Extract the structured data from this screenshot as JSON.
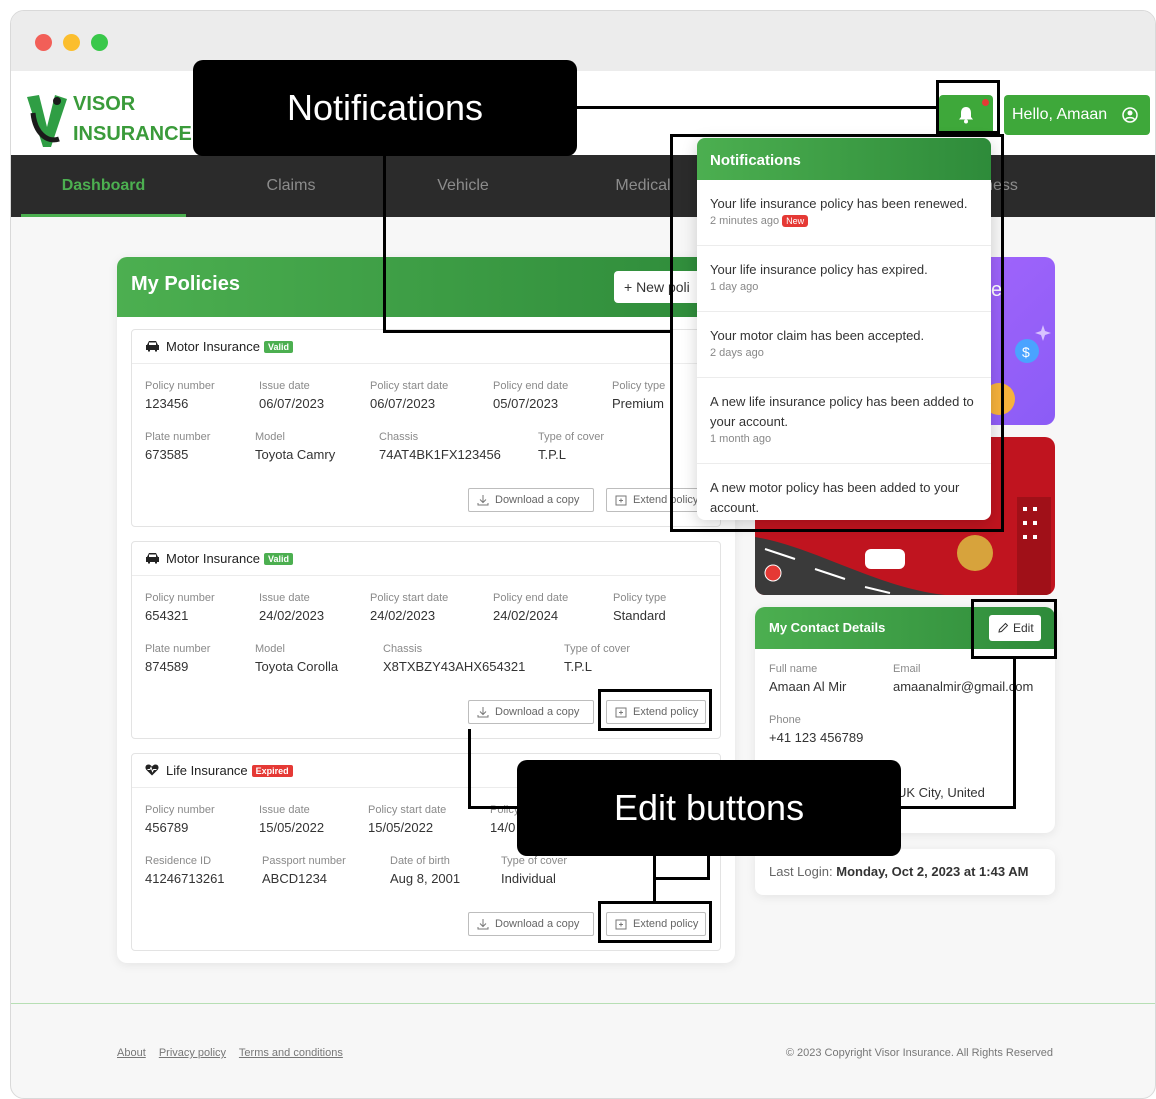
{
  "brand": {
    "line1": "VISOR",
    "line2": "INSURANCE"
  },
  "header": {
    "greeting": "Hello, Amaan"
  },
  "nav": [
    "Dashboard",
    "Claims",
    "Vehicle",
    "Medical",
    "ness"
  ],
  "policies": {
    "title": "My Policies",
    "new_label": "+ New poli",
    "download_label": "Download a copy",
    "extend_label": "Extend policy",
    "extend_label_clipped": "Extend policy",
    "cards": [
      {
        "title": "Motor Insurance",
        "badge": "Valid",
        "row1": [
          {
            "label": "Policy number",
            "value": "123456"
          },
          {
            "label": "Issue date",
            "value": "06/07/2023"
          },
          {
            "label": "Policy start date",
            "value": "06/07/2023"
          },
          {
            "label": "Policy end date",
            "value": "05/07/2023"
          },
          {
            "label": "Policy type",
            "value": "Premium"
          }
        ],
        "row2": [
          {
            "label": "Plate number",
            "value": "673585"
          },
          {
            "label": "Model",
            "value": "Toyota Camry"
          },
          {
            "label": "Chassis",
            "value": "74AT4BK1FX123456"
          },
          {
            "label": "Type of cover",
            "value": "T.P.L"
          }
        ]
      },
      {
        "title": "Motor Insurance",
        "badge": "Valid",
        "row1": [
          {
            "label": "Policy number",
            "value": "654321"
          },
          {
            "label": "Issue date",
            "value": "24/02/2023"
          },
          {
            "label": "Policy start date",
            "value": "24/02/2023"
          },
          {
            "label": "Policy end date",
            "value": "24/02/2024"
          },
          {
            "label": "Policy type",
            "value": "Standard"
          }
        ],
        "row2": [
          {
            "label": "Plate number",
            "value": "874589"
          },
          {
            "label": "Model",
            "value": "Toyota Corolla"
          },
          {
            "label": "Chassis",
            "value": "X8TXBZY43AHX654321"
          },
          {
            "label": "Type of cover",
            "value": "T.P.L"
          }
        ]
      },
      {
        "title": "Life Insurance",
        "badge": "Expired",
        "row1": [
          {
            "label": "Policy number",
            "value": "456789"
          },
          {
            "label": "Issue date",
            "value": "15/05/2022"
          },
          {
            "label": "Policy start date",
            "value": "15/05/2022"
          },
          {
            "label": "Policy",
            "value": "14/0"
          }
        ],
        "row2": [
          {
            "label": "Residence ID",
            "value": "41246713261"
          },
          {
            "label": "Passport number",
            "value": "ABCD1234"
          },
          {
            "label": "Date of birth",
            "value": "Aug 8, 2001"
          },
          {
            "label": "Type of cover",
            "value": "Individual"
          }
        ]
      }
    ]
  },
  "contact": {
    "title": "My Contact Details",
    "edit_label": "Edit",
    "fullname_label": "Full name",
    "fullname": "Amaan Al Mir",
    "email_label": "Email",
    "email": "amaanalmir@gmail.com",
    "phone_label": "Phone",
    "phone": "+41 123 456789",
    "address_partial": "UK City, United"
  },
  "last_login": {
    "label": "Last Login:",
    "value": "Monday, Oct 2, 2023 at 1:43 AM"
  },
  "promo1_partial": "e",
  "notifications": {
    "title": "Notifications",
    "new_badge": "New",
    "items": [
      {
        "text": "Your life insurance policy has been renewed.",
        "time": "2 minutes ago"
      },
      {
        "text": "Your life insurance policy has expired.",
        "time": "1 day ago"
      },
      {
        "text": "Your motor claim has been accepted.",
        "time": "2 days ago"
      },
      {
        "text": "A new life insurance policy has been added to your account.",
        "time": "1 month ago"
      },
      {
        "text": "A new motor policy has been added to your account.",
        "time": ""
      }
    ]
  },
  "footer": {
    "links": [
      "About",
      "Privacy policy",
      "Terms and conditions"
    ],
    "copyright": "© 2023 Copyright Visor Insurance. All Rights Reserved"
  },
  "callouts": {
    "notifications": "Notifications",
    "edit": "Edit buttons"
  },
  "colors": {
    "brand_green": "#3ea83a",
    "nav_bg": "#2b2b2b",
    "expired_red": "#e53935"
  }
}
